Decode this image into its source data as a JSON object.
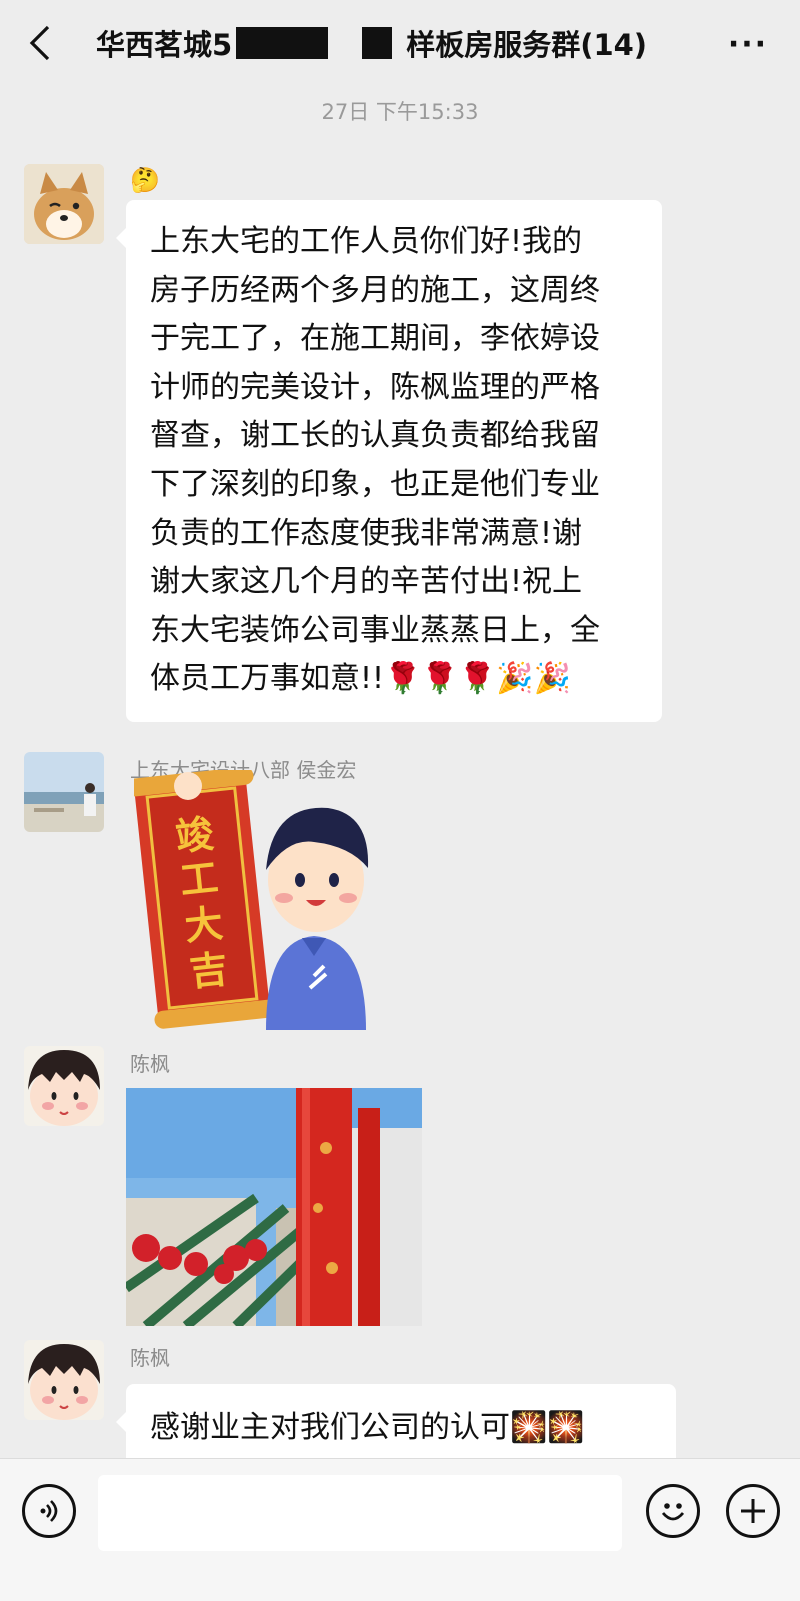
{
  "header": {
    "back_icon": "chevron-left-icon",
    "title_prefix": "华西茗城5",
    "title_suffix": "样板房服务群(14)",
    "more_label": "···"
  },
  "timestamp": "27日 下午15:33",
  "messages": [
    {
      "sender": "",
      "emoji_prefix": "🤔",
      "lines": [
        "上东大宅的工作人员你们好!我的",
        "房子历经两个多月的施工，这周终",
        "于完工了，在施工期间，李依婷设",
        "计师的完美设计，陈枫监理的严格",
        "督查，谢工长的认真负责都给我留",
        "下了深刻的印象，也正是他们专业",
        "负责的工作态度使我非常满意!谢",
        "谢大家这几个月的辛苦付出!祝上",
        "东大宅装饰公司事业蒸蒸日上，全",
        "体员工万事如意!!🌹🌹🌹🎉🎉"
      ]
    },
    {
      "sender": "上东大宅设计八部 侯金宏",
      "sticker_text": [
        "竣",
        "工",
        "大",
        "吉"
      ]
    },
    {
      "sender": "陈枫",
      "photo": "red-banner-photo"
    },
    {
      "sender": "陈枫",
      "text": "感谢业主对我们公司的认可🎇🎇"
    }
  ],
  "bottombar": {
    "voice_icon": "voice-icon",
    "emoji_icon": "emoji-icon",
    "plus_icon": "plus-icon",
    "input_value": ""
  }
}
